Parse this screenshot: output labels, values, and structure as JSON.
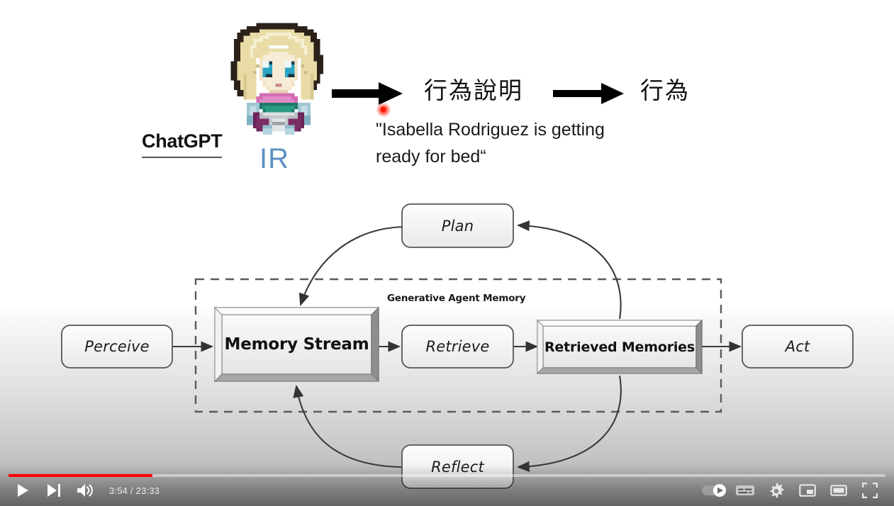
{
  "slide": {
    "top": {
      "chatgpt_label": "ChatGPT",
      "avatar_initials": "IR",
      "avatar_icon": "pixel-character-avatar",
      "arrow1_icon": "right-arrow-icon",
      "arrow2_icon": "right-arrow-icon",
      "cjk_behavior_description": "行為說明",
      "cjk_behavior": "行為",
      "quote": "\"Isabella Rodriguez is getting ready for bed“",
      "laser_icon": "laser-pointer-dot"
    },
    "diagram": {
      "container_caption": "Generative Agent Memory",
      "nodes": [
        {
          "id": "perceive",
          "label": "Perceive",
          "style": "rounded"
        },
        {
          "id": "memory-stream",
          "label": "Memory Stream",
          "style": "beveled-bold"
        },
        {
          "id": "retrieve",
          "label": "Retrieve",
          "style": "rounded"
        },
        {
          "id": "retrieved-memories",
          "label": "Retrieved Memories",
          "style": "beveled-bold"
        },
        {
          "id": "act",
          "label": "Act",
          "style": "rounded"
        },
        {
          "id": "plan",
          "label": "Plan",
          "style": "rounded"
        },
        {
          "id": "reflect",
          "label": "Reflect",
          "style": "rounded"
        }
      ]
    }
  },
  "player": {
    "time_display": "3:54 / 23:33",
    "current_time": "3:54",
    "duration": "23:33",
    "progress_percent": 16.4,
    "progress_color": "#ff0000",
    "controls_left": [
      {
        "name": "play-button",
        "icon": "play-icon"
      },
      {
        "name": "next-button",
        "icon": "next-track-icon"
      },
      {
        "name": "volume-button",
        "icon": "volume-icon"
      }
    ],
    "controls_right": [
      {
        "name": "autoplay-toggle",
        "icon": "autoplay-toggle-icon"
      },
      {
        "name": "subtitles-button",
        "icon": "closed-captions-icon"
      },
      {
        "name": "settings-button",
        "icon": "gear-icon"
      },
      {
        "name": "miniplayer-button",
        "icon": "miniplayer-icon"
      },
      {
        "name": "theater-button",
        "icon": "theater-mode-icon"
      },
      {
        "name": "fullscreen-button",
        "icon": "fullscreen-icon"
      }
    ]
  }
}
